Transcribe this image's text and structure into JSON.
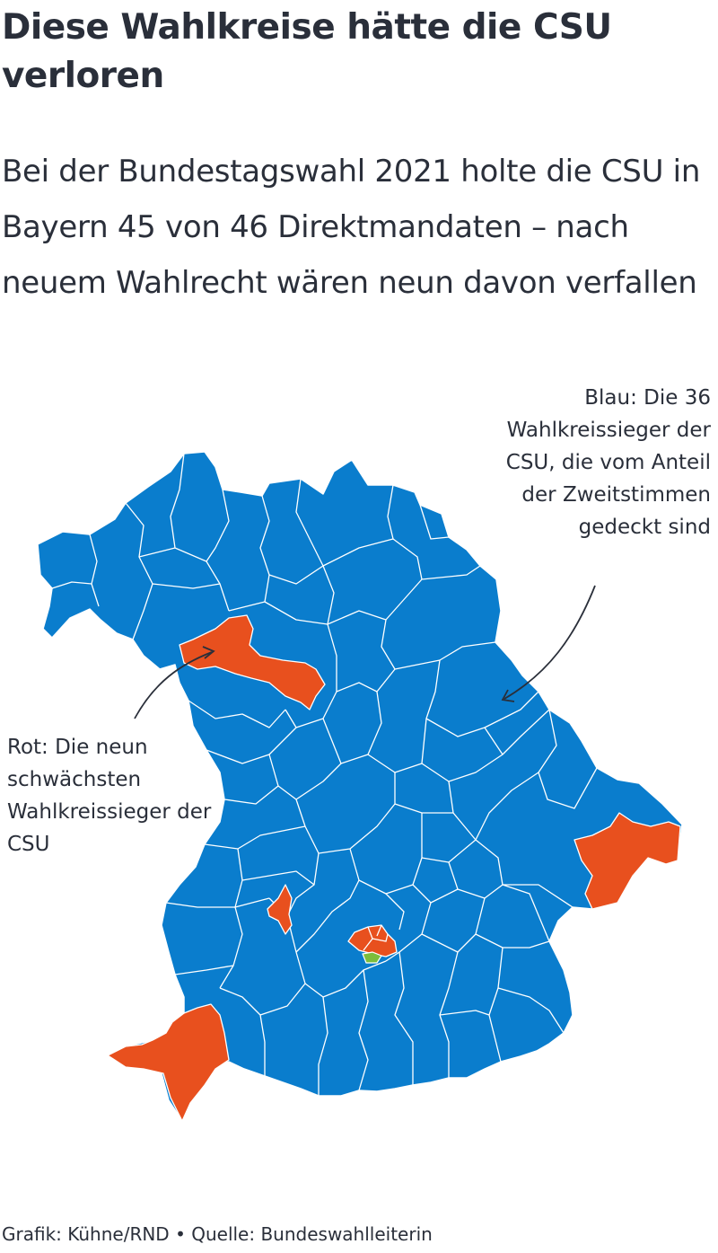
{
  "title": "Diese Wahlkreise hätte die CSU verloren",
  "subtitle": "Bei der Bundestagswahl 2021 holte die CSU in Bayern 45 von 46 Direktmandaten – nach neuem Wahlrecht wären neun davon verfallen",
  "legend": {
    "blue": {
      "text": "Blau: Die 36 Wahlkreissieger der CSU, die vom Anteil der Zweitstimmen gedeckt sind",
      "color": "#0a7dcd"
    },
    "red": {
      "text": "Rot: Die neun schwächsten Wahlkreissieger der CSU",
      "color": "#e8501e"
    },
    "green_color": "#7cbd3c"
  },
  "footer": {
    "credit": "Grafik: Kühne/RND",
    "separator": "•",
    "source": "Quelle: Bundeswahlleiterin"
  },
  "map": {
    "region": "Bayern",
    "districts_total": 46,
    "csu_direct_mandates": 45,
    "covered_by_second_votes": 36,
    "lost_under_new_law": 9
  }
}
